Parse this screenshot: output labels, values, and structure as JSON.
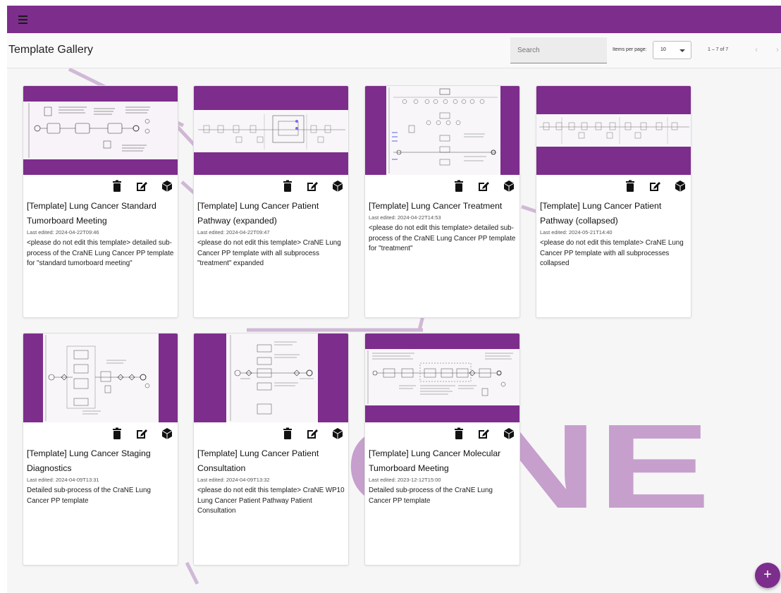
{
  "header": {
    "title": "Template Gallery",
    "search_placeholder": "Search",
    "items_per_page_label": "Items per page:",
    "items_per_page_value": "10",
    "range_label": "1 – 7 of 7"
  },
  "fab_label": "+",
  "colors": {
    "brand": "#7d2d8c",
    "background_logo": "#c49bcb"
  },
  "background_logo_text": "ONE",
  "cards": [
    {
      "title": "[Template] Lung Cancer Standard Tumorboard Meeting",
      "edited": "Last edited: 2024-04-22T09:46",
      "description": "<please do not edit this template> detailed sub-process of the CraNE Lung Cancer PP template for \"standard tumorboard meeting\""
    },
    {
      "title": "[Template] Lung Cancer Patient Pathway (expanded)",
      "edited": "Last edited: 2024-04-22T09:47",
      "description": "<please do not edit this template> CraNE Lung Cancer PP template with all subprocess \"treatment\" expanded"
    },
    {
      "title": "[Template] Lung Cancer Treatment",
      "edited": "Last edited: 2024-04-22T14:53",
      "description": "<please do not edit this template> detailed sub-process of the CraNE Lung Cancer PP template for \"treatment\""
    },
    {
      "title": "[Template] Lung Cancer Patient Pathway (collapsed)",
      "edited": "Last edited: 2024-05-21T14:40",
      "description": "<please do not edit this template> CraNE Lung Cancer PP template with all subprocesses collapsed"
    },
    {
      "title": "[Template] Lung Cancer Staging Diagnostics",
      "edited": "Last edited: 2024-04-09T13:31",
      "description": "Detailed sub-process of the CraNE Lung Cancer PP template"
    },
    {
      "title": "[Template] Lung Cancer Patient Consultation",
      "edited": "Last edited: 2024-04-09T13:32",
      "description": "<please do not edit this template> CraNE WP10 Lung Cancer Patient Pathway Patient Consultation"
    },
    {
      "title": "[Template] Lung Cancer Molecular Tumorboard Meeting",
      "edited": "Last edited: 2023-12-12T15:00",
      "description": "Detailed sub-process of the CraNE Lung Cancer PP template"
    }
  ]
}
